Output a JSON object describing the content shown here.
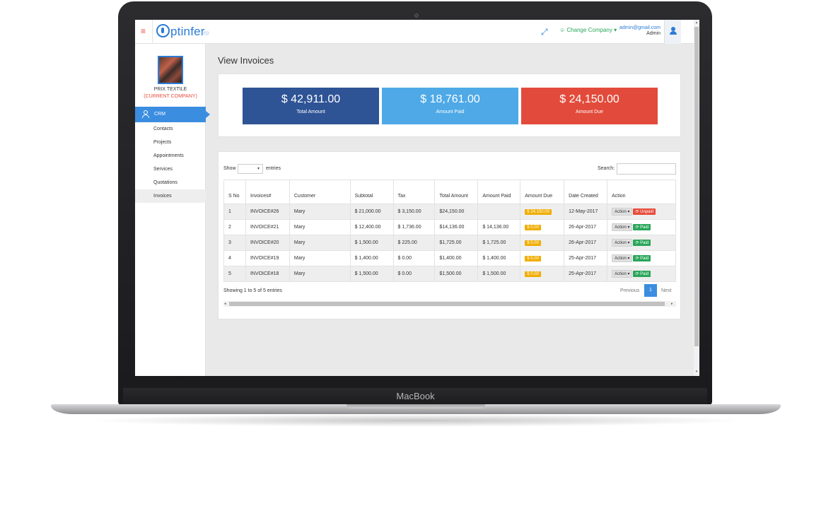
{
  "device": {
    "label": "MacBook"
  },
  "header": {
    "logo_text": "ptinfer",
    "logo_sub": "erp",
    "change_company": "☺ Change Company ▾",
    "user_email": "admin@gmail.com",
    "user_role": "Admin"
  },
  "sidebar": {
    "company_name": "PRIX TEXTILE",
    "company_tag": "(CURRENT COMPANY)",
    "section": "CRM",
    "items": [
      {
        "label": "Contacts"
      },
      {
        "label": "Projects"
      },
      {
        "label": "Appointments"
      },
      {
        "label": "Services"
      },
      {
        "label": "Quotations"
      },
      {
        "label": "Invoices",
        "active": true
      }
    ]
  },
  "main": {
    "title": "View Invoices",
    "stats": [
      {
        "amount": "$ 42,911.00",
        "label": "Total Amount",
        "color": "#2f5496"
      },
      {
        "amount": "$ 18,761.00",
        "label": "Amount Paid",
        "color": "#4ea9e6"
      },
      {
        "amount": "$ 24,150.00",
        "label": "Amount Due",
        "color": "#e24b3b"
      }
    ],
    "table_controls": {
      "show_label": "Show",
      "entries_value": "▾",
      "entries_label": "entries",
      "search_label": "Search:"
    },
    "columns": [
      "S No",
      "Invoices#",
      "Customer",
      "Subtotal",
      "Tax",
      "Total Amount",
      "Amount Paid",
      "Amount Due",
      "Date Created",
      "Action"
    ],
    "rows": [
      {
        "sno": "1",
        "invoice": "INVOICE#26",
        "customer": "Mary",
        "subtotal": "$ 21,000.00",
        "tax": "$ 3,150.00",
        "total": "$24,150.00",
        "paid": "",
        "due": "$ 24,150.00",
        "date": "12-May-2017",
        "action": "Action ▾",
        "status": "Unpaid"
      },
      {
        "sno": "2",
        "invoice": "INVOICE#21",
        "customer": "Mary",
        "subtotal": "$ 12,400.00",
        "tax": "$ 1,736.00",
        "total": "$14,136.00",
        "paid": "$ 14,136.00",
        "due": "$ 0.00",
        "date": "26-Apr-2017",
        "action": "Action ▾",
        "status": "Paid"
      },
      {
        "sno": "3",
        "invoice": "INVOICE#20",
        "customer": "Mary",
        "subtotal": "$ 1,500.00",
        "tax": "$ 225.00",
        "total": "$1,725.00",
        "paid": "$ 1,725.00",
        "due": "$ 0.00",
        "date": "26-Apr-2017",
        "action": "Action ▾",
        "status": "Paid"
      },
      {
        "sno": "4",
        "invoice": "INVOICE#19",
        "customer": "Mary",
        "subtotal": "$ 1,400.00",
        "tax": "$ 0.00",
        "total": "$1,400.00",
        "paid": "$ 1,400.00",
        "due": "$ 0.00",
        "date": "25-Apr-2017",
        "action": "Action ▾",
        "status": "Paid"
      },
      {
        "sno": "5",
        "invoice": "INVOICE#18",
        "customer": "Mary",
        "subtotal": "$ 1,500.00",
        "tax": "$ 0.00",
        "total": "$1,500.00",
        "paid": "$ 1,500.00",
        "due": "$ 0.00",
        "date": "25-Apr-2017",
        "action": "Action ▾",
        "status": "Paid"
      }
    ],
    "footer": {
      "info": "Showing 1 to 5 of 5 entries",
      "prev": "Previous",
      "page": "1",
      "next": "Next"
    }
  }
}
